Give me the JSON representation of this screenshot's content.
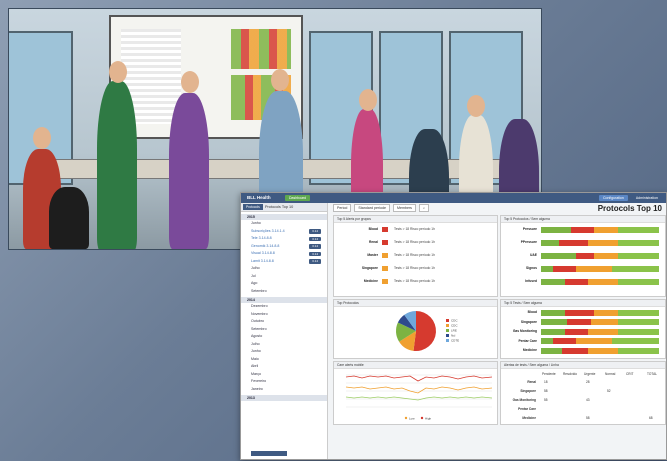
{
  "app": {
    "brand": "BLL Health",
    "badge": "Dashboard",
    "top_buttons": [
      "Configuration",
      "Administration"
    ],
    "side_tabs": [
      "Protocols"
    ],
    "side_title": "Protocols Top 10",
    "page_title": "Protocols Top 10"
  },
  "sidebar": {
    "sections": [
      {
        "label": "2015",
        "items": [
          {
            "label": "Junho",
            "blue": false,
            "pill": ""
          },
          {
            "label": "Subscrições 3.14.1.4",
            "blue": true,
            "pill": "3.14"
          },
          {
            "label": "Tele 3.14.8.8",
            "blue": true,
            "pill": "3.14"
          },
          {
            "label": "Genomik 3.14.8.8",
            "blue": true,
            "pill": "3.14"
          },
          {
            "label": "Visual 3.14.8.8",
            "blue": true,
            "pill": "3.14"
          },
          {
            "label": "Lamit 3.14.8.8",
            "blue": true,
            "pill": "3.14"
          },
          {
            "label": "Julho",
            "blue": false,
            "pill": ""
          },
          {
            "label": "Jul",
            "blue": false,
            "pill": ""
          },
          {
            "label": "Ago",
            "blue": false,
            "pill": ""
          },
          {
            "label": "Setembro",
            "blue": false,
            "pill": ""
          }
        ]
      },
      {
        "label": "2014",
        "items": [
          {
            "label": "Dezembro",
            "blue": false,
            "pill": ""
          },
          {
            "label": "Novembro",
            "blue": false,
            "pill": ""
          },
          {
            "label": "Outubro",
            "blue": false,
            "pill": ""
          },
          {
            "label": "Setembro",
            "blue": false,
            "pill": ""
          },
          {
            "label": "Agosto",
            "blue": false,
            "pill": ""
          },
          {
            "label": "Julho",
            "blue": false,
            "pill": ""
          },
          {
            "label": "Junho",
            "blue": false,
            "pill": ""
          },
          {
            "label": "Maio",
            "blue": false,
            "pill": ""
          },
          {
            "label": "Abril",
            "blue": false,
            "pill": ""
          },
          {
            "label": "Março",
            "blue": false,
            "pill": ""
          },
          {
            "label": "Fevereiro",
            "blue": false,
            "pill": ""
          },
          {
            "label": "Janeiro",
            "blue": false,
            "pill": ""
          }
        ]
      },
      {
        "label": "2013",
        "items": []
      }
    ]
  },
  "filters": [
    "Period",
    "Standard periode",
    "Members"
  ],
  "panels": {
    "status_title": "Top 5 Alerts por grupos",
    "status_rows": [
      {
        "label": "Blood",
        "color": "#d63a2f",
        "text": "Tests > 18 Risco período 1h"
      },
      {
        "label": "Renal",
        "color": "#d63a2f",
        "text": "Tests > 18 Risco período 1h"
      },
      {
        "label": "Master",
        "color": "#f0a030",
        "text": "Tests > 18 Risco período 1h"
      },
      {
        "label": "Singapore",
        "color": "#f0a030",
        "text": "Tests > 18 Risco período 1h"
      },
      {
        "label": "Medicine",
        "color": "#f0a030",
        "text": "Tests > 18 Risco período 1h"
      }
    ],
    "bars1_title": "Top 5 Protocolos / Sem alguma",
    "bars1": [
      {
        "label": "Pressure",
        "segs": [
          0.25,
          0.2,
          0.2,
          0.35
        ]
      },
      {
        "label": "PPressure",
        "segs": [
          0.15,
          0.25,
          0.25,
          0.35
        ]
      },
      {
        "label": "UAE",
        "segs": [
          0.3,
          0.15,
          0.2,
          0.35
        ]
      },
      {
        "label": "Signos",
        "segs": [
          0.1,
          0.2,
          0.3,
          0.4
        ]
      },
      {
        "label": "Infused",
        "segs": [
          0.2,
          0.2,
          0.25,
          0.35
        ]
      }
    ],
    "pie_title": "Top Protocolos",
    "pie_legend": [
      "CDC",
      "CDC",
      "LRE",
      "Ncl",
      "CDTE"
    ],
    "pie_colors": [
      "#d63a2f",
      "#f0a030",
      "#7cb342",
      "#2e4a8c",
      "#6fa8dc"
    ],
    "bars2_title": "Top 5 Tests / Sem alguma",
    "bars2": [
      {
        "label": "Blood",
        "segs": [
          0.2,
          0.25,
          0.2,
          0.35
        ]
      },
      {
        "label": "Singapore",
        "segs": [
          0.22,
          0.2,
          0.23,
          0.35
        ]
      },
      {
        "label": "Gas Monitoring",
        "segs": [
          0.2,
          0.2,
          0.25,
          0.35
        ]
      },
      {
        "label": "Pentar Care",
        "segs": [
          0.1,
          0.2,
          0.3,
          0.4
        ]
      },
      {
        "label": "Medicine",
        "segs": [
          0.18,
          0.22,
          0.25,
          0.35
        ]
      }
    ],
    "bar_colors": [
      "#7cb342",
      "#d63a2f",
      "#f0a030",
      "#8bc34a"
    ],
    "line_title": "Care alerts mobile",
    "line_legend": [
      "Low",
      "High"
    ],
    "table_title": "Alertas de tests / Sem alguma / Linha",
    "table_headers": [
      "Pendente",
      "Resolvido",
      "Urgente",
      "Normal",
      "CRIT",
      "TOTAL"
    ],
    "table_rows": [
      {
        "label": "Renal",
        "cells": [
          "18",
          "",
          "28",
          "",
          "",
          ""
        ]
      },
      {
        "label": "Singapore",
        "cells": [
          "58",
          "",
          "",
          "52",
          "",
          ""
        ]
      },
      {
        "label": "Gas Monitoring",
        "cells": [
          "55",
          "",
          "43",
          "",
          "",
          ""
        ]
      },
      {
        "label": "Pentar Care",
        "cells": [
          "",
          "",
          "",
          "",
          "",
          ""
        ]
      },
      {
        "label": "Medicine",
        "cells": [
          "",
          "",
          "58",
          "",
          "",
          "68"
        ]
      }
    ]
  }
}
